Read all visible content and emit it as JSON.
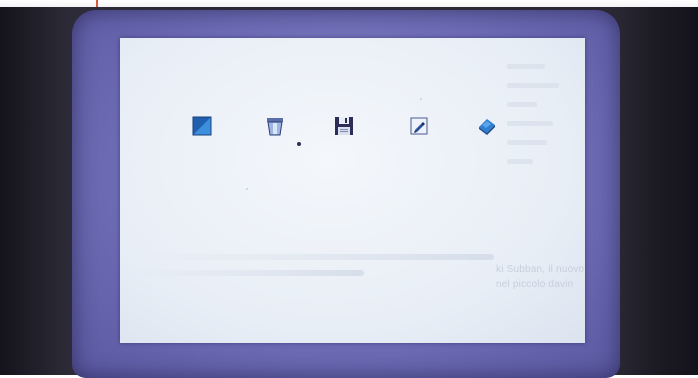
{
  "photo": {
    "colors": {
      "bezel": "#6e6db6",
      "screen": "#eef2f8",
      "icon_blue": "#2d78c8",
      "icon_dark": "#2c2e57"
    }
  },
  "desktop": {
    "icons": [
      {
        "name": "blue-square-icon"
      },
      {
        "name": "trash-can-icon"
      },
      {
        "name": "floppy-disk-icon"
      },
      {
        "name": "pen-document-icon"
      },
      {
        "name": "eraser-icon"
      }
    ],
    "caption": {
      "line1": "ki Subban, il nuovo system sesi computer",
      "line2": "nel piccolo davin"
    }
  }
}
